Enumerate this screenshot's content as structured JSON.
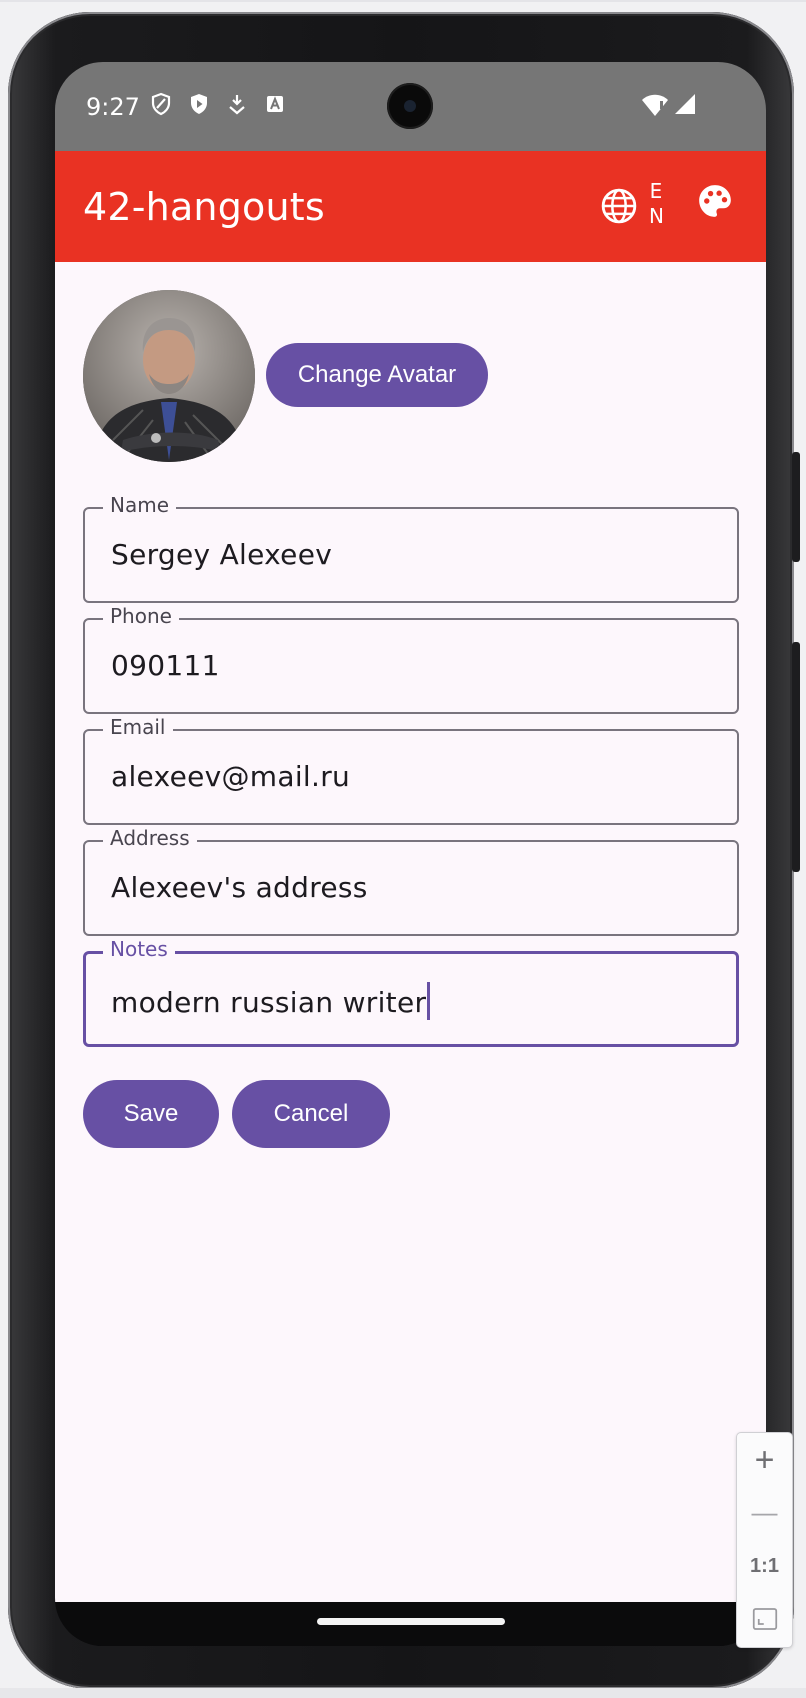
{
  "status_bar": {
    "time": "9:27",
    "left_icons": [
      "shield-outline-icon",
      "shield-play-icon",
      "download-icon",
      "a-box-icon"
    ],
    "right_icons": [
      "wifi-alert-icon",
      "signal-icon"
    ]
  },
  "app_bar": {
    "title": "42-hangouts",
    "language_code_line1": "E",
    "language_code_line2": "N",
    "icons": [
      "globe-icon",
      "palette-icon"
    ],
    "color": "#e93223"
  },
  "profile": {
    "change_avatar_label": "Change Avatar",
    "accent_color": "#6750a4"
  },
  "form": {
    "name_label": "Name",
    "name_value": "Sergey Alexeev",
    "phone_label": "Phone",
    "phone_value": "090111",
    "email_label": "Email",
    "email_value": "alexeev@mail.ru",
    "address_label": "Address",
    "address_value": "Alexeev's address",
    "notes_label": "Notes",
    "notes_value": "modern russian writer"
  },
  "actions": {
    "save_label": "Save",
    "cancel_label": "Cancel"
  },
  "zoom_panel": {
    "zoom_in": "+",
    "zoom_out": "—",
    "actual_size": "1:1"
  }
}
